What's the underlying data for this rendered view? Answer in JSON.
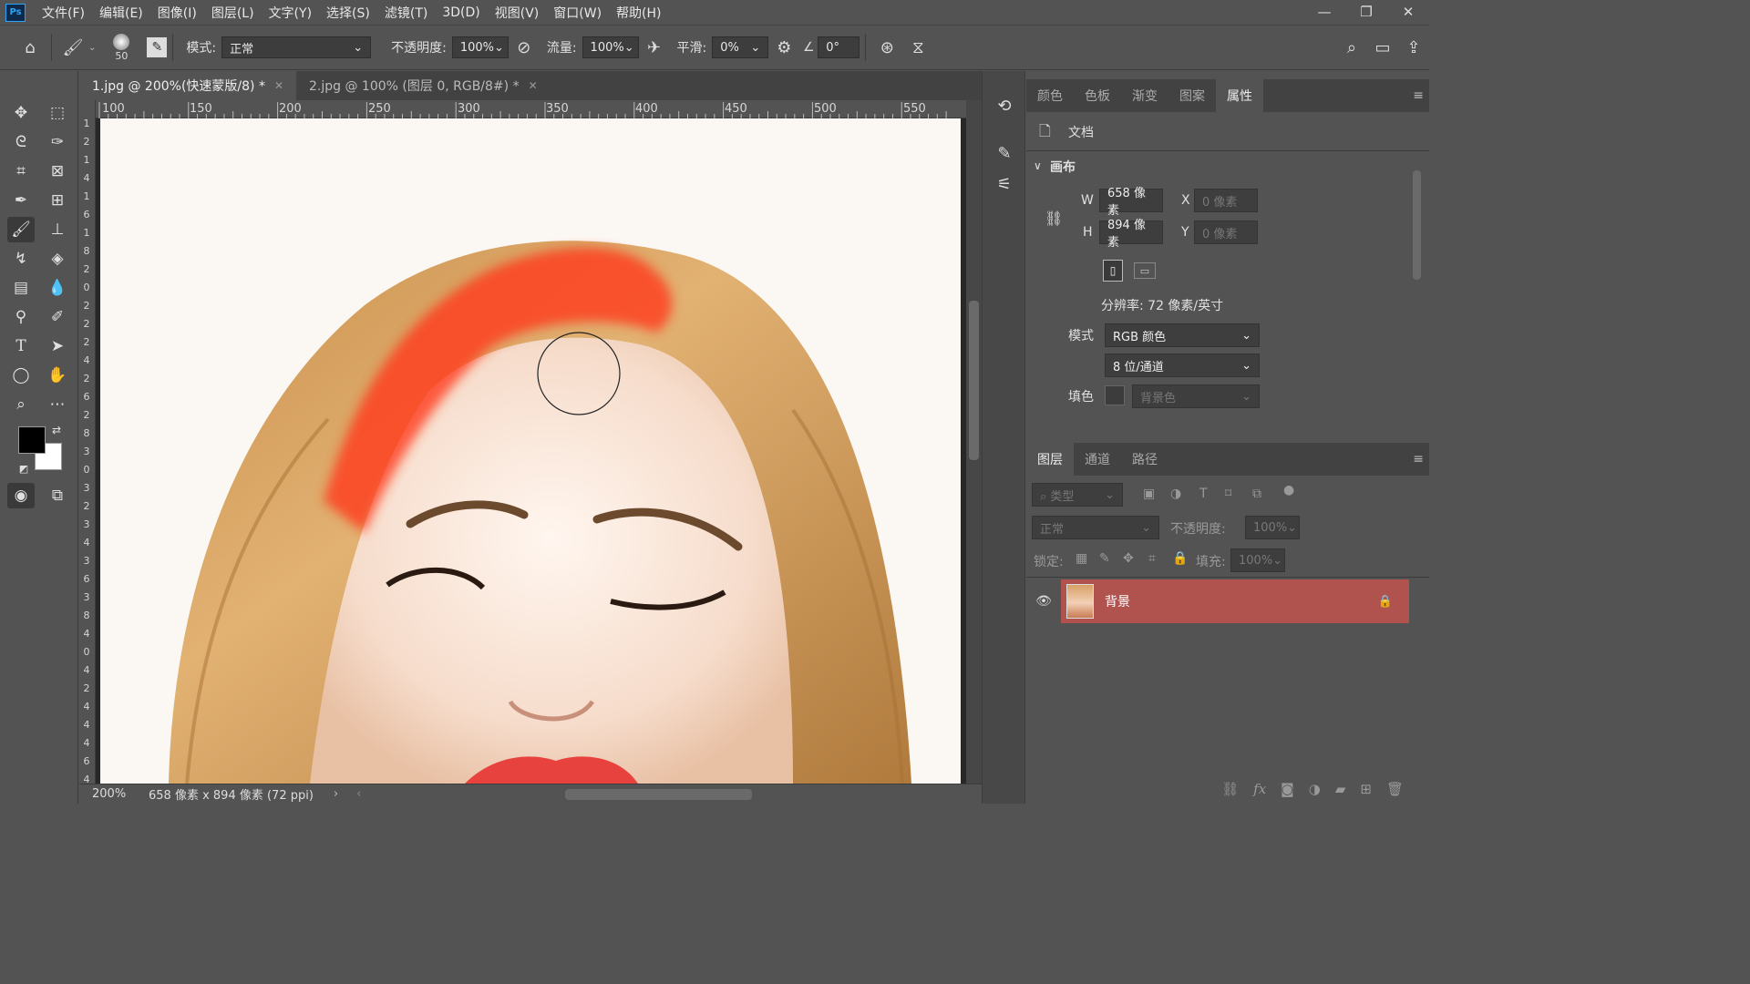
{
  "menubar": {
    "logo": "Ps",
    "items": [
      "文件(F)",
      "编辑(E)",
      "图像(I)",
      "图层(L)",
      "文字(Y)",
      "选择(S)",
      "滤镜(T)",
      "3D(D)",
      "视图(V)",
      "窗口(W)",
      "帮助(H)"
    ]
  },
  "options": {
    "brush_size": "50",
    "mode_label": "模式:",
    "mode_value": "正常",
    "opacity_label": "不透明度:",
    "opacity_value": "100%",
    "flow_label": "流量:",
    "flow_value": "100%",
    "smooth_label": "平滑:",
    "smooth_value": "0%",
    "angle_value": "0°"
  },
  "tabs": [
    {
      "label": "1.jpg @ 200%(快速蒙版/8) *"
    },
    {
      "label": "2.jpg @ 100% (图层 0, RGB/8#) *"
    }
  ],
  "ruler": {
    "h_ticks": [
      "100",
      "150",
      "200",
      "250",
      "300",
      "350",
      "400",
      "450",
      "500",
      "550"
    ],
    "v_ticks": [
      "1",
      "2",
      "1",
      "4",
      "1",
      "6",
      "1",
      "8",
      "2",
      "0",
      "2",
      "2",
      "2",
      "4",
      "2",
      "6",
      "2",
      "8",
      "3",
      "0",
      "3",
      "2",
      "3",
      "4",
      "3",
      "6",
      "3",
      "8",
      "4",
      "0",
      "4",
      "2",
      "4",
      "4",
      "4",
      "6",
      "4"
    ]
  },
  "statusbar": {
    "zoom": "200%",
    "doc_info": "658 像素 x 894 像素 (72 ppi)"
  },
  "properties": {
    "tabs": [
      "颜色",
      "色板",
      "渐变",
      "图案",
      "属性"
    ],
    "active_tab": 4,
    "doc_label": "文档",
    "canvas_section": "画布",
    "w_label": "W",
    "w_value": "658 像素",
    "h_label": "H",
    "h_value": "894 像素",
    "x_label": "X",
    "x_value": "0 像素",
    "y_label": "Y",
    "y_value": "0 像素",
    "resolution": "分辨率: 72 像素/英寸",
    "mode_label": "模式",
    "mode_value": "RGB 颜色",
    "depth_value": "8 位/通道",
    "fill_label": "填色",
    "fill_value": "背景色"
  },
  "layers": {
    "tabs": [
      "图层",
      "通道",
      "路径"
    ],
    "filter_value": "类型",
    "blend_mode": "正常",
    "opacity_label": "不透明度:",
    "opacity_value": "100%",
    "lock_label": "锁定:",
    "fill_label": "填充:",
    "fill_value": "100%",
    "items": [
      {
        "name": "背景"
      }
    ]
  },
  "colors": {
    "selected_layer": "#b0534f",
    "quick_mask": "#ff3a1a"
  }
}
